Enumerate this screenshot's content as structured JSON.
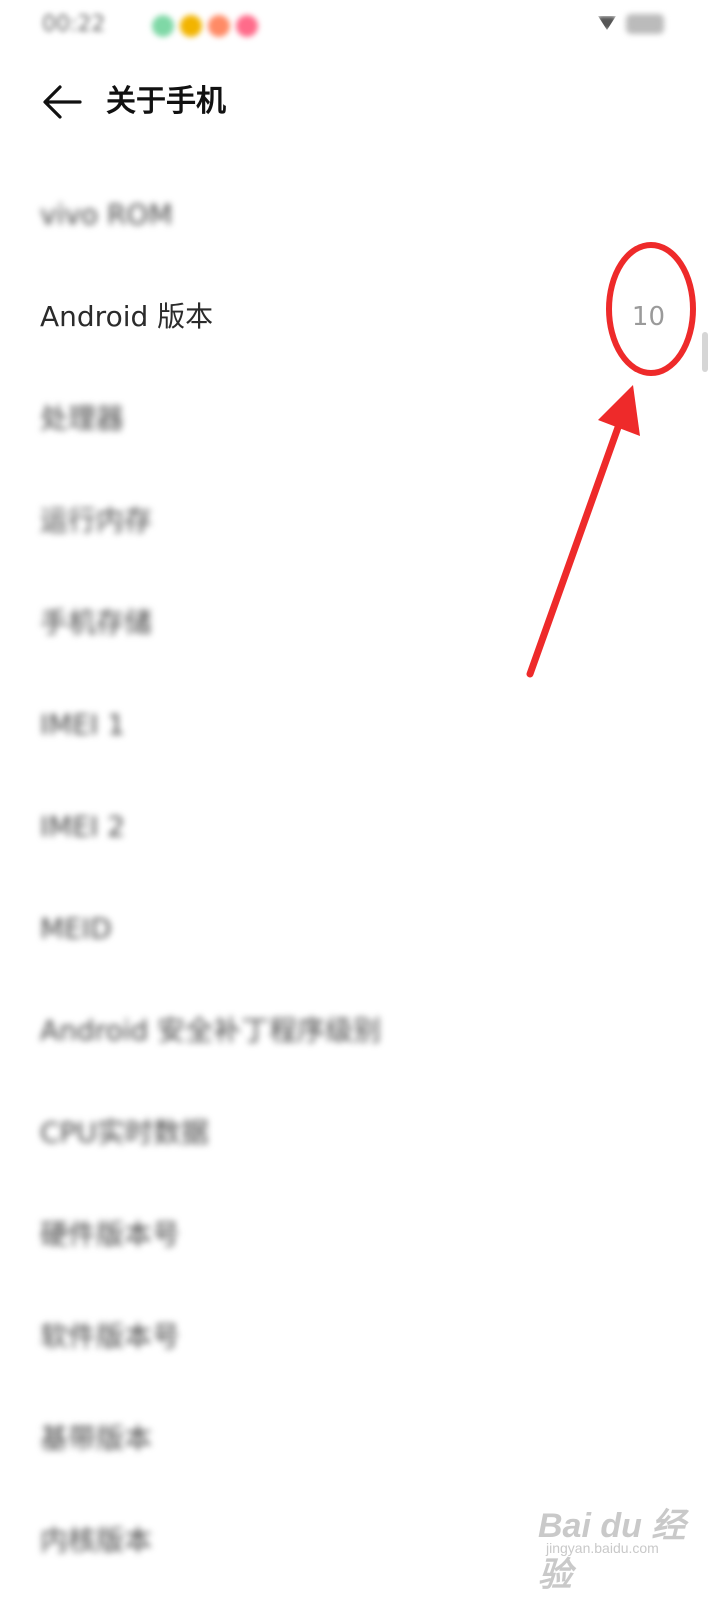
{
  "status_bar": {
    "time": "00:22",
    "dot_colors": [
      "#7fd8a6",
      "#f2b400",
      "#ff8a65",
      "#ff6b8a"
    ]
  },
  "header": {
    "title": "关于手机",
    "back_icon": "arrow-left-icon"
  },
  "list": {
    "items": [
      {
        "label": "vivo ROM",
        "value": "",
        "blurred": true
      },
      {
        "label": "Android 版本",
        "value": "10",
        "blurred": false
      },
      {
        "label": "处理器",
        "value": "",
        "blurred": true
      },
      {
        "label": "运行内存",
        "value": "",
        "blurred": true
      },
      {
        "label": "手机存储",
        "value": "",
        "blurred": true
      },
      {
        "label": "IMEI 1",
        "value": "",
        "blurred": true
      },
      {
        "label": "IMEI 2",
        "value": "",
        "blurred": true
      },
      {
        "label": "MEID",
        "value": "",
        "blurred": true
      },
      {
        "label": "Android 安全补丁程序级别",
        "value": "",
        "blurred": true
      },
      {
        "label": "CPU实时数据",
        "value": "",
        "blurred": true
      },
      {
        "label": "硬件版本号",
        "value": "",
        "blurred": true
      },
      {
        "label": "软件版本号",
        "value": "",
        "blurred": true
      },
      {
        "label": "基带版本",
        "value": "",
        "blurred": true
      },
      {
        "label": "内核版本",
        "value": "",
        "blurred": true
      }
    ]
  },
  "annotation": {
    "color": "#ee2a2a"
  },
  "watermark": {
    "main": "Bai du 经验",
    "sub": "jingyan.baidu.com"
  }
}
